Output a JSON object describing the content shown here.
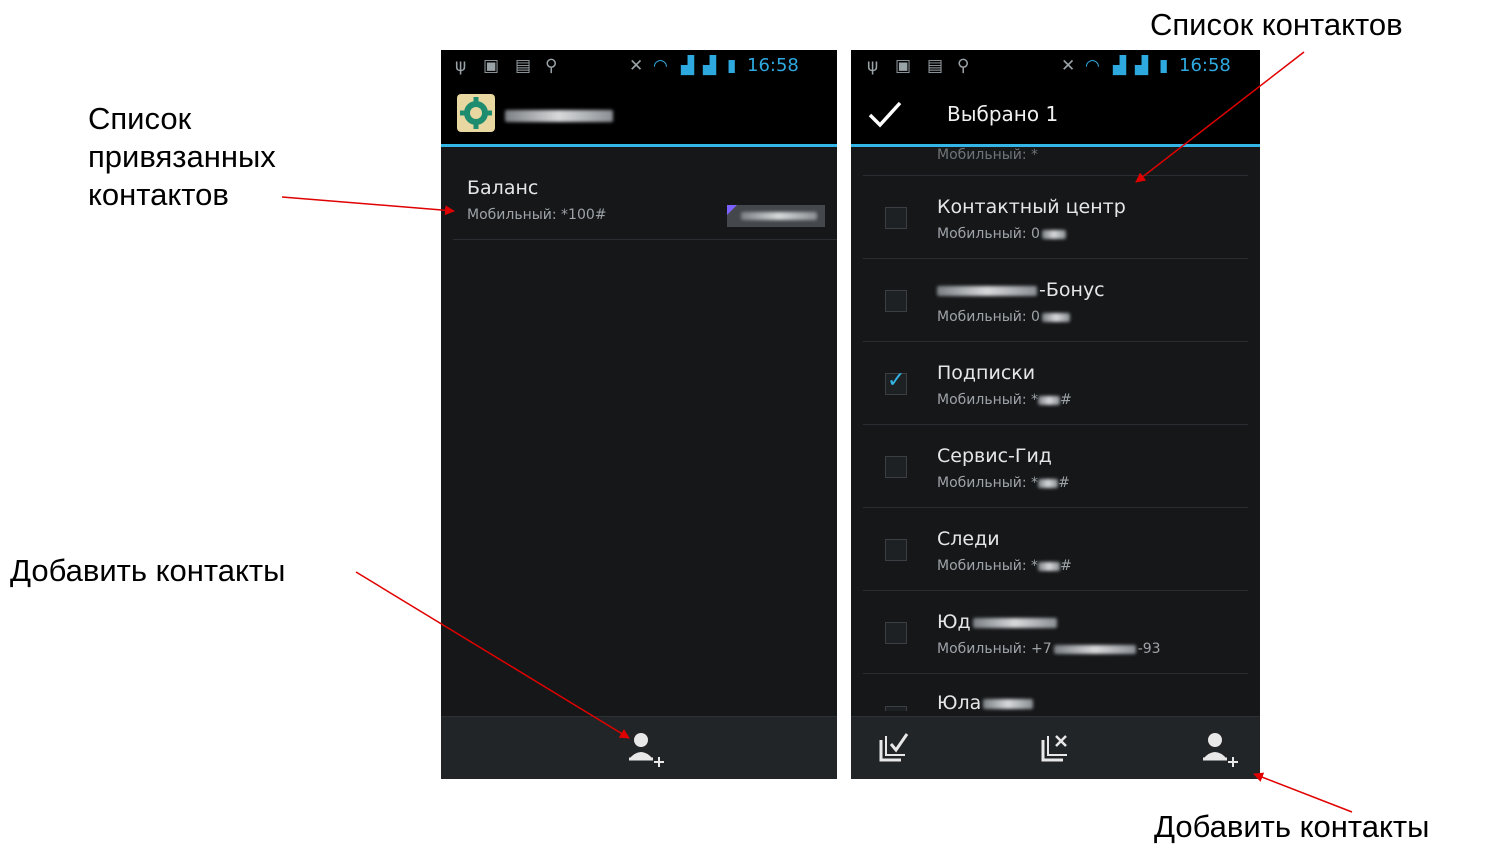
{
  "callouts": {
    "linked_list": "Список привязанных контактов",
    "linked_list_l1": "Список",
    "linked_list_l2": "привязанных",
    "linked_list_l3": "контактов",
    "contact_list": "Список контактов",
    "add_contacts_left": "Добавить контакты",
    "add_contacts_right": "Добавить контакты"
  },
  "status_bar": {
    "time": "16:58"
  },
  "left_screen": {
    "linked_contacts": [
      {
        "name": "Баланс",
        "number": "Мобильный: *100#"
      }
    ]
  },
  "right_screen": {
    "selected_label": "Выбрано 1",
    "partial_top": "Мобильный: *",
    "contacts": [
      {
        "name": "Контактный центр",
        "number": "Мобильный: 0",
        "checked": false
      },
      {
        "name": "-Бонус",
        "number": "Мобильный: 0",
        "checked": false
      },
      {
        "name": "Подписки",
        "number": "Мобильный: *",
        "number_suffix": "#",
        "checked": true
      },
      {
        "name": "Сервис-Гид",
        "number": "Мобильный: *",
        "number_suffix": "#",
        "checked": false
      },
      {
        "name": "Следи",
        "number": "Мобильный: *",
        "number_suffix": "#",
        "checked": false
      },
      {
        "name": "Юд",
        "number": "Мобильный: +7",
        "number_suffix": "-93",
        "checked": false
      },
      {
        "name": "Юла",
        "number": "",
        "checked": false
      }
    ]
  },
  "icons": {
    "done": "check-icon",
    "settings": "gear-icon",
    "select_all": "select-all-icon",
    "clear_selection": "clear-selection-icon",
    "add_contact": "add-contact-icon"
  },
  "colors": {
    "accent": "#33b5e5",
    "arrow": "#e00000"
  }
}
